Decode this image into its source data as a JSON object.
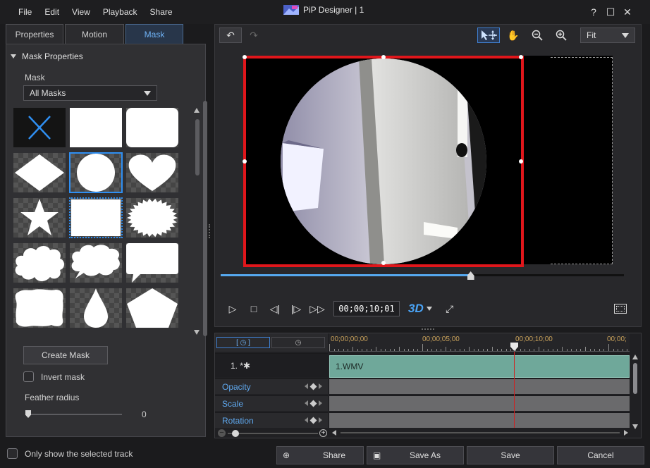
{
  "menu": [
    "File",
    "Edit",
    "View",
    "Playback",
    "Share"
  ],
  "window": {
    "title": "PiP Designer  |  1",
    "help": "?"
  },
  "tabs": [
    {
      "label": "Properties",
      "active": false
    },
    {
      "label": "Motion",
      "active": false
    },
    {
      "label": "Mask",
      "active": true
    }
  ],
  "mask_panel": {
    "section_title": "Mask Properties",
    "mask_label": "Mask",
    "mask_select_value": "All Masks",
    "create_button": "Create Mask",
    "invert_label": "Invert mask",
    "feather_label": "Feather radius",
    "feather_value": "0",
    "masks": [
      "none",
      "rectangle",
      "rounded-rectangle",
      "diamond",
      "circle",
      "heart",
      "star",
      "rectangle-inset",
      "burst",
      "cloud",
      "speech-cloud",
      "speech-bubble",
      "wavy-frame",
      "drop",
      "pentagon"
    ],
    "selected_mask": "circle"
  },
  "preview": {
    "zoom_value": "Fit",
    "timecode": "00;00;10;01",
    "three_d": "3D",
    "progress": 0.62
  },
  "timeline": {
    "ruler": [
      "00;00;00;00",
      "00;00;05;00",
      "00;00;10;00",
      "00;00;"
    ],
    "track_name": "1.  *✱",
    "clip_label": "1.WMV",
    "attributes": [
      "Opacity",
      "Scale",
      "Rotation"
    ]
  },
  "bottom": {
    "only_selected_label": "Only show the selected track",
    "share": "Share",
    "save_as": "Save As",
    "save": "Save",
    "cancel": "Cancel"
  },
  "colors": {
    "accent": "#2f8ff2",
    "frame": "#e0161b",
    "clip": "#6fa89a"
  }
}
